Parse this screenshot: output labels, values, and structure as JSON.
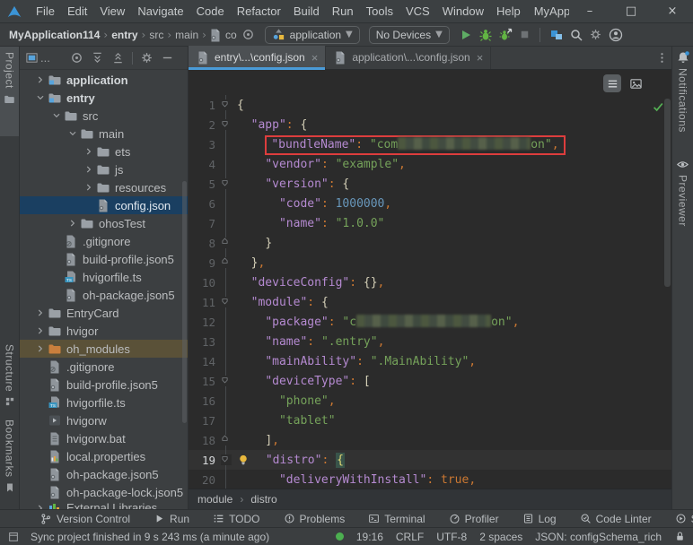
{
  "window": {
    "menu": [
      "File",
      "Edit",
      "View",
      "Navigate",
      "Code",
      "Refactor",
      "Build",
      "Run",
      "Tools",
      "VCS",
      "Window",
      "Help"
    ],
    "title": "MyApplicatio",
    "controls": {
      "minimize": "–",
      "maximize": "□",
      "close": "×"
    }
  },
  "toolbar": {
    "breadcrumbs": [
      {
        "label": "MyApplication114",
        "bold": true
      },
      {
        "label": "entry",
        "bold": true
      },
      {
        "label": "src",
        "bold": false
      },
      {
        "label": "main",
        "bold": false
      }
    ],
    "file_crumb": "co",
    "run_config": {
      "label": "application",
      "icon": "runconfig"
    },
    "device_selector": {
      "label": "No Devices"
    },
    "actions": [
      {
        "icon": "play",
        "name": "run-button"
      },
      {
        "icon": "bug",
        "name": "debug-button"
      },
      {
        "icon": "bug-attach",
        "name": "attach-debugger-button"
      },
      {
        "icon": "stop",
        "name": "stop-button"
      }
    ],
    "right_icons": [
      {
        "icon": "devices",
        "name": "device-manager-button"
      },
      {
        "icon": "search",
        "name": "search-everywhere-button"
      },
      {
        "icon": "gear",
        "name": "settings-button"
      },
      {
        "icon": "avatar",
        "name": "profile-button"
      }
    ]
  },
  "left_strip": {
    "project": "Project",
    "structure": "Structure",
    "bookmarks": "Bookmarks"
  },
  "project_panel": {
    "selector_dots": "...",
    "tree": [
      {
        "d": 0,
        "c": "r",
        "i": "folder-module",
        "l": "application",
        "bold": true
      },
      {
        "d": 0,
        "c": "d",
        "i": "folder-module",
        "l": "entry",
        "bold": true
      },
      {
        "d": 1,
        "c": "d",
        "i": "folder",
        "l": "src"
      },
      {
        "d": 2,
        "c": "d",
        "i": "folder",
        "l": "main"
      },
      {
        "d": 3,
        "c": "r",
        "i": "folder",
        "l": "ets"
      },
      {
        "d": 3,
        "c": "r",
        "i": "folder",
        "l": "js"
      },
      {
        "d": 3,
        "c": "r",
        "i": "folder",
        "l": "resources"
      },
      {
        "d": 3,
        "c": null,
        "i": "file-json",
        "l": "config.json",
        "sel": true
      },
      {
        "d": 2,
        "c": "r",
        "i": "folder",
        "l": "ohosTest"
      },
      {
        "d": 1,
        "c": null,
        "i": "file-gitignore",
        "l": ".gitignore"
      },
      {
        "d": 1,
        "c": null,
        "i": "file-json",
        "l": "build-profile.json5"
      },
      {
        "d": 1,
        "c": null,
        "i": "file-ts",
        "l": "hvigorfile.ts"
      },
      {
        "d": 1,
        "c": null,
        "i": "file-json",
        "l": "oh-package.json5"
      },
      {
        "d": 0,
        "c": "r",
        "i": "folder",
        "l": "EntryCard"
      },
      {
        "d": 0,
        "c": "r",
        "i": "folder",
        "l": "hvigor"
      },
      {
        "d": 0,
        "c": "r",
        "i": "folder-orange",
        "l": "oh_modules",
        "hl": true
      },
      {
        "d": 0,
        "c": null,
        "i": "file-gitignore",
        "l": ".gitignore"
      },
      {
        "d": 0,
        "c": null,
        "i": "file-json",
        "l": "build-profile.json5"
      },
      {
        "d": 0,
        "c": null,
        "i": "file-ts",
        "l": "hvigorfile.ts"
      },
      {
        "d": 0,
        "c": null,
        "i": "file-script",
        "l": "hvigorw"
      },
      {
        "d": 0,
        "c": null,
        "i": "file-bat",
        "l": "hvigorw.bat"
      },
      {
        "d": 0,
        "c": null,
        "i": "file-properties",
        "l": "local.properties"
      },
      {
        "d": 0,
        "c": null,
        "i": "file-json",
        "l": "oh-package.json5"
      },
      {
        "d": 0,
        "c": null,
        "i": "file-json",
        "l": "oh-package-lock.json5"
      },
      {
        "d": 0,
        "c": "r",
        "i": "lib",
        "l": "External Libraries",
        "partial": true
      }
    ]
  },
  "editor": {
    "tabs": [
      {
        "label": "entry\\...\\config.json",
        "icon": "file-json",
        "active": true
      },
      {
        "label": "application\\...\\config.json",
        "icon": "file-json",
        "active": false
      }
    ],
    "lines": [
      {
        "n": 1,
        "f": "open",
        "t": [
          [
            "b",
            "{"
          ]
        ]
      },
      {
        "n": 2,
        "f": "open",
        "t": [
          [
            "w",
            "  "
          ],
          [
            "k",
            "\"app\""
          ],
          [
            "p",
            ": "
          ],
          [
            "b",
            "{"
          ]
        ]
      },
      {
        "n": 3,
        "t": [
          [
            "w",
            "    "
          ],
          [
            "k",
            "\"bundleName\""
          ],
          [
            "p",
            ": "
          ],
          [
            "s",
            "\"com"
          ],
          [
            "blur",
            "",
            148
          ],
          [
            "s",
            "on\""
          ],
          [
            "p",
            ","
          ]
        ],
        "box": [
          1,
          6
        ]
      },
      {
        "n": 4,
        "t": [
          [
            "w",
            "    "
          ],
          [
            "k",
            "\"vendor\""
          ],
          [
            "p",
            ": "
          ],
          [
            "s",
            "\"example\""
          ],
          [
            "p",
            ","
          ]
        ]
      },
      {
        "n": 5,
        "f": "open",
        "t": [
          [
            "w",
            "    "
          ],
          [
            "k",
            "\"version\""
          ],
          [
            "p",
            ": "
          ],
          [
            "b",
            "{"
          ]
        ]
      },
      {
        "n": 6,
        "t": [
          [
            "w",
            "      "
          ],
          [
            "k",
            "\"code\""
          ],
          [
            "p",
            ": "
          ],
          [
            "num",
            "1000000"
          ],
          [
            "p",
            ","
          ]
        ]
      },
      {
        "n": 7,
        "t": [
          [
            "w",
            "      "
          ],
          [
            "k",
            "\"name\""
          ],
          [
            "p",
            ": "
          ],
          [
            "s",
            "\"1.0.0\""
          ]
        ]
      },
      {
        "n": 8,
        "f": "close",
        "t": [
          [
            "w",
            "    "
          ],
          [
            "b",
            "}"
          ]
        ]
      },
      {
        "n": 9,
        "f": "close",
        "t": [
          [
            "w",
            "  "
          ],
          [
            "b",
            "}"
          ],
          [
            "p",
            ","
          ]
        ]
      },
      {
        "n": 10,
        "t": [
          [
            "w",
            "  "
          ],
          [
            "k",
            "\"deviceConfig\""
          ],
          [
            "p",
            ": "
          ],
          [
            "b",
            "{}"
          ],
          [
            "p",
            ","
          ]
        ]
      },
      {
        "n": 11,
        "f": "open",
        "t": [
          [
            "w",
            "  "
          ],
          [
            "k",
            "\"module\""
          ],
          [
            "p",
            ": "
          ],
          [
            "b",
            "{"
          ]
        ]
      },
      {
        "n": 12,
        "t": [
          [
            "w",
            "    "
          ],
          [
            "k",
            "\"package\""
          ],
          [
            "p",
            ": "
          ],
          [
            "s",
            "\"c"
          ],
          [
            "blur",
            "",
            150
          ],
          [
            "s",
            "on\""
          ],
          [
            "p",
            ","
          ]
        ]
      },
      {
        "n": 13,
        "t": [
          [
            "w",
            "    "
          ],
          [
            "k",
            "\"name\""
          ],
          [
            "p",
            ": "
          ],
          [
            "s",
            "\".entry\""
          ],
          [
            "p",
            ","
          ]
        ]
      },
      {
        "n": 14,
        "t": [
          [
            "w",
            "    "
          ],
          [
            "k",
            "\"mainAbility\""
          ],
          [
            "p",
            ": "
          ],
          [
            "s",
            "\".MainAbility\""
          ],
          [
            "p",
            ","
          ]
        ]
      },
      {
        "n": 15,
        "f": "open",
        "t": [
          [
            "w",
            "    "
          ],
          [
            "k",
            "\"deviceType\""
          ],
          [
            "p",
            ": "
          ],
          [
            "b",
            "["
          ]
        ]
      },
      {
        "n": 16,
        "t": [
          [
            "w",
            "      "
          ],
          [
            "s",
            "\"phone\""
          ],
          [
            "p",
            ","
          ]
        ]
      },
      {
        "n": 17,
        "t": [
          [
            "w",
            "      "
          ],
          [
            "s",
            "\"tablet\""
          ]
        ]
      },
      {
        "n": 18,
        "f": "close",
        "t": [
          [
            "w",
            "    "
          ],
          [
            "b",
            "]"
          ],
          [
            "p",
            ","
          ]
        ]
      },
      {
        "n": 19,
        "f": "open",
        "cur": true,
        "t": [
          [
            "bulb",
            ""
          ],
          [
            "w",
            " "
          ],
          [
            "k",
            "\"distro\""
          ],
          [
            "p",
            ": "
          ],
          [
            "bh",
            "{"
          ]
        ]
      },
      {
        "n": 20,
        "t": [
          [
            "w",
            "      "
          ],
          [
            "k",
            "\"deliveryWithInstall\""
          ],
          [
            "p",
            ": "
          ],
          [
            "bool",
            "true"
          ],
          [
            "p",
            ","
          ]
        ]
      }
    ],
    "breadcrumb": [
      "module",
      "distro"
    ]
  },
  "right_strip": {
    "notifications": "Notifications",
    "previewer": "Previewer"
  },
  "bottom_bar": [
    {
      "icon": "branch",
      "label": "Version Control"
    },
    {
      "icon": "run-small",
      "label": "Run"
    },
    {
      "icon": "todo",
      "label": "TODO"
    },
    {
      "icon": "problems",
      "label": "Problems"
    },
    {
      "icon": "terminal",
      "label": "Terminal"
    },
    {
      "icon": "profiler",
      "label": "Profiler"
    },
    {
      "icon": "log",
      "label": "Log"
    },
    {
      "icon": "linter",
      "label": "Code Linter"
    },
    {
      "icon": "services",
      "label": "Services"
    }
  ],
  "status_bar": {
    "message": "Sync project finished in 9 s 243 ms (a minute ago)",
    "time": "19:16",
    "line_ending": "CRLF",
    "encoding": "UTF-8",
    "indent": "2 spaces",
    "file_type": "JSON: configSchema_rich"
  },
  "colors": {
    "accent_blue": "#4a9bd8",
    "selection_blue": "#1a3f61",
    "highlight_olive": "#5a5138",
    "run_green": "#62b543",
    "error_red": "#dd3d3d",
    "bulb_yellow": "#e8b83d",
    "ok_green": "#54b054",
    "status_dot_green": "#4caf50"
  }
}
